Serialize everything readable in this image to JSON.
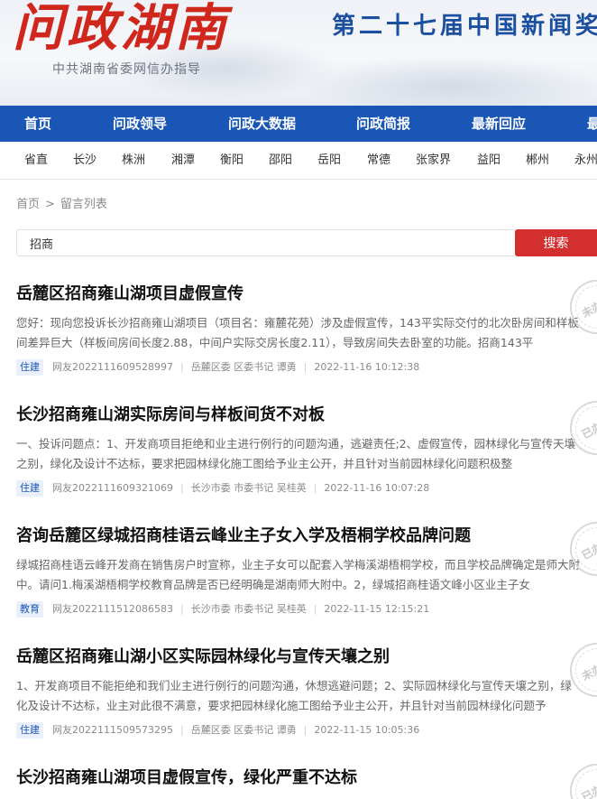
{
  "header": {
    "logo": "问政湖南",
    "subtitle": "中共湖南省委网信办指导",
    "slogan": "第二十七届中国新闻奖"
  },
  "main_nav": [
    "首页",
    "问政领导",
    "问政大数据",
    "问政简报",
    "最新回应",
    "最"
  ],
  "region_nav": [
    "省直",
    "长沙",
    "株洲",
    "湘潭",
    "衡阳",
    "邵阳",
    "岳阳",
    "常德",
    "张家界",
    "益阳",
    "郴州",
    "永州"
  ],
  "breadcrumb": {
    "home": "首页",
    "separator": ">",
    "current": "留言列表"
  },
  "search": {
    "value": "招商",
    "button": "搜索"
  },
  "items": [
    {
      "title": "岳麓区招商雍山湖项目虚假宣传",
      "summary": "您好：现向您投诉长沙招商雍山湖项目（项目名：雍麓花苑）涉及虚假宣传，143平实际交付的北次卧房间和样板间差异巨大（样板间房间长度2.88，中间户实际交房长度2.11），导致房间失去卧室的功能。招商143平",
      "tag": "住建",
      "user": "网友2022111609528997",
      "dept": "岳麓区委 区委书记 谭勇",
      "time": "2022-11-16 10:12:38",
      "status": "未办理"
    },
    {
      "title": "长沙招商雍山湖实际房间与样板间货不对板",
      "summary": "一、投诉问题点：1、开发商项目拒绝和业主进行例行的问题沟通，逃避责任;2、虚假宣传，园林绿化与宣传天壤之别，绿化及设计不达标，要求把园林绿化施工图给予业主公开，并且针对当前园林绿化问题积极整",
      "tag": "住建",
      "user": "网友2022111609321069",
      "dept": "长沙市委 市委书记 吴桂英",
      "time": "2022-11-16 10:07:28",
      "status": "已办理"
    },
    {
      "title": "咨询岳麓区绿城招商桂语云峰业主子女入学及梧桐学校品牌问题",
      "summary": "绿城招商桂语云峰开发商在销售房户时宣称，业主子女可以配套入学梅溪湖梧桐学校，而且学校品牌确定是师大附中。请问1.梅溪湖梧桐学校教育品牌是否已经明确是湖南师大附中。2，绿城招商桂语文峰小区业主子女",
      "tag": "教育",
      "user": "网友2022111512086583",
      "dept": "长沙市委 市委书记 吴桂英",
      "time": "2022-11-15 12:15:21",
      "status": "已办理"
    },
    {
      "title": "岳麓区招商雍山湖小区实际园林绿化与宣传天壤之别",
      "summary": "1、开发商项目不能拒绝和我们业主进行例行的问题沟通，休想逃避问题；2、实际园林绿化与宣传天壤之别，绿化及设计不达标，业主对此很不满意，要求把园林绿化施工图给予业主公开，并且针对当前园林绿化问题予",
      "tag": "住建",
      "user": "网友2022111509573295",
      "dept": "岳麓区委 区委书记 谭勇",
      "time": "2022-11-15 10:05:36",
      "status": "未办理"
    },
    {
      "title": "长沙招商雍山湖项目虚假宣传，绿化严重不达标",
      "summary": "",
      "tag": "",
      "user": "",
      "dept": "",
      "time": "",
      "status": "已办理"
    }
  ]
}
